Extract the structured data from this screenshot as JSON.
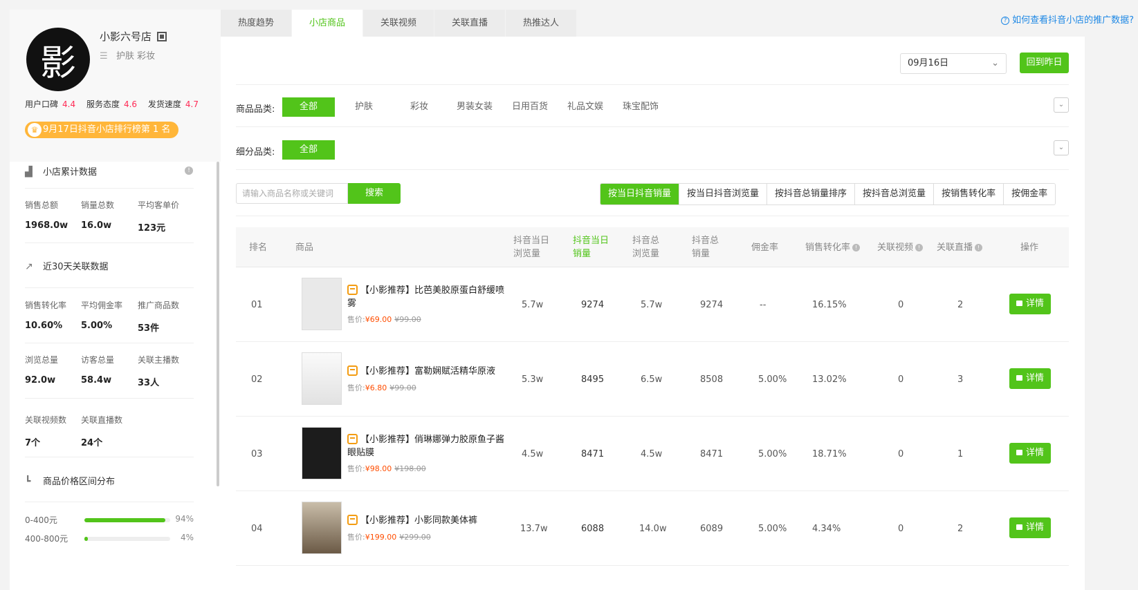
{
  "shop": {
    "avatar_glyph": "影",
    "name": "小影六号店",
    "categories": "护肤 彩妆",
    "ratings": [
      {
        "label": "用户口碑",
        "value": "4.4"
      },
      {
        "label": "服务态度",
        "value": "4.6"
      },
      {
        "label": "发货速度",
        "value": "4.7"
      }
    ],
    "rank_badge": "9月17日抖音小店排行榜第 1 名"
  },
  "cumulative": {
    "title": "小店累计数据",
    "stats": [
      {
        "label": "销售总额",
        "value": "1968.0w"
      },
      {
        "label": "销量总数",
        "value": "16.0w"
      },
      {
        "label": "平均客单价",
        "value": "123元"
      }
    ]
  },
  "recent30": {
    "title": "近30天关联数据",
    "stats": [
      {
        "label": "销售转化率",
        "value": "10.60%"
      },
      {
        "label": "平均佣金率",
        "value": "5.00%"
      },
      {
        "label": "推广商品数",
        "value": "53件"
      },
      {
        "label": "浏览总量",
        "value": "92.0w"
      },
      {
        "label": "访客总量",
        "value": "58.4w"
      },
      {
        "label": "关联主播数",
        "value": "33人"
      },
      {
        "label": "关联视频数",
        "value": "7个"
      },
      {
        "label": "关联直播数",
        "value": "24个"
      }
    ]
  },
  "price_dist": {
    "title": "商品价格区间分布",
    "rows": [
      {
        "label": "0-400元",
        "pct": "94%",
        "fraction": 0.94
      },
      {
        "label": "400-800元",
        "pct": "4%",
        "fraction": 0.04
      }
    ]
  },
  "tabs": [
    "热度趋势",
    "小店商品",
    "关联视频",
    "关联直播",
    "热推达人"
  ],
  "active_tab": 1,
  "help_link": "如何查看抖音小店的推广数据?",
  "date": {
    "value": "09月16日",
    "back_label": "回到昨日"
  },
  "filters": {
    "category_label": "商品品类:",
    "categories": [
      "全部",
      "护肤",
      "彩妆",
      "男装女装",
      "日用百货",
      "礼品文娱",
      "珠宝配饰"
    ],
    "sub_label": "细分品类:",
    "sub_categories": [
      "全部"
    ]
  },
  "search": {
    "placeholder": "请输入商品名称或关键词",
    "button": "搜索"
  },
  "sort_options": [
    "按当日抖音销量",
    "按当日抖音浏览量",
    "按抖音总销量排序",
    "按抖音总浏览量",
    "按销售转化率",
    "按佣金率"
  ],
  "table": {
    "headers": {
      "rank": "排名",
      "product": "商品",
      "day_views": [
        "抖音当日",
        "浏览量"
      ],
      "day_sales": [
        "抖音当日",
        "销量"
      ],
      "total_views": [
        "抖音总",
        "浏览量"
      ],
      "total_sales": [
        "抖音总",
        "销量"
      ],
      "commission": "佣金率",
      "conversion": "销售转化率",
      "videos": "关联视频",
      "lives": "关联直播",
      "action": "操作"
    },
    "price_label": "售价:",
    "detail_label": "详情",
    "rows": [
      {
        "rank": "01",
        "title": "【小影推荐】比芭美胶原蛋白舒缓喷雾",
        "price": "¥69.00",
        "old_price": "¥99.00",
        "day_views": "5.7w",
        "day_sales": "9274",
        "total_views": "5.7w",
        "total_sales": "9274",
        "commission": "--",
        "conversion": "16.15%",
        "videos": "0",
        "lives": "2"
      },
      {
        "rank": "02",
        "title": "【小影推荐】富勒娴赋活精华原液",
        "price": "¥6.80",
        "old_price": "¥99.00",
        "day_views": "5.3w",
        "day_sales": "8495",
        "total_views": "6.5w",
        "total_sales": "8508",
        "commission": "5.00%",
        "conversion": "13.02%",
        "videos": "0",
        "lives": "3"
      },
      {
        "rank": "03",
        "title": "【小影推荐】俏琳娜弹力胶原鱼子酱眼贴膜",
        "price": "¥98.00",
        "old_price": "¥198.00",
        "day_views": "4.5w",
        "day_sales": "8471",
        "total_views": "4.5w",
        "total_sales": "8471",
        "commission": "5.00%",
        "conversion": "18.71%",
        "videos": "0",
        "lives": "1"
      },
      {
        "rank": "04",
        "title": "【小影推荐】小影同款美体裤",
        "price": "¥199.00",
        "old_price": "¥299.00",
        "day_views": "13.7w",
        "day_sales": "6088",
        "total_views": "14.0w",
        "total_sales": "6089",
        "commission": "5.00%",
        "conversion": "4.34%",
        "videos": "0",
        "lives": "2"
      }
    ]
  }
}
